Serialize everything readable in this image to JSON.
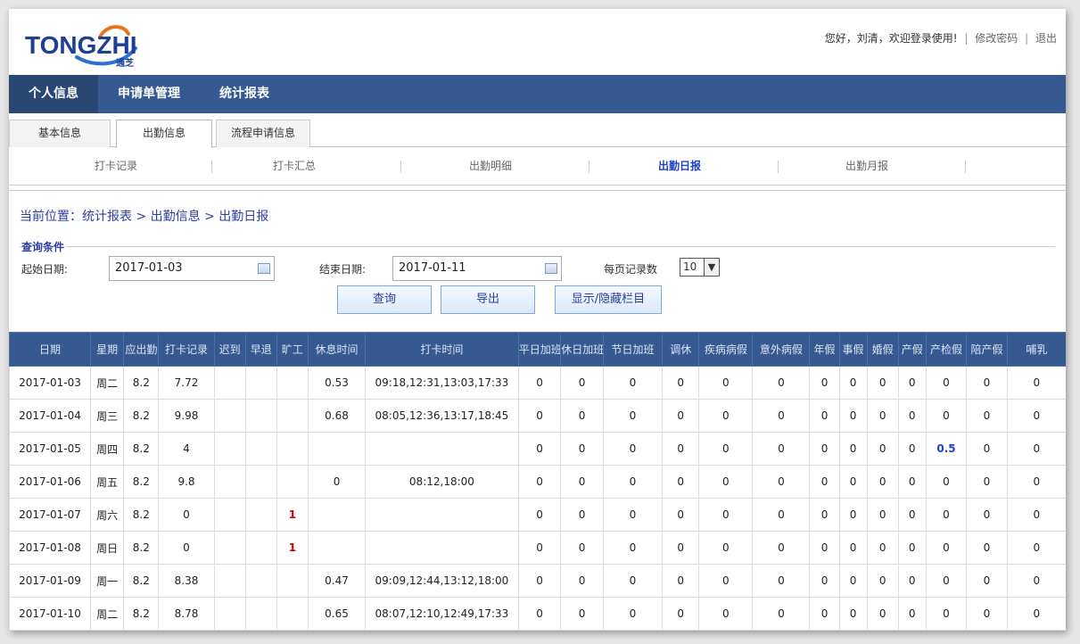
{
  "header": {
    "logo_text": "TONGZHI",
    "logo_sub": "通芝",
    "greeting": "您好，刘清，欢迎登录使用!",
    "change_password": "修改密码",
    "logout": "退出",
    "sep": "|"
  },
  "nav": [
    "个人信息",
    "申请单管理",
    "统计报表"
  ],
  "tabs": [
    "基本信息",
    "出勤信息",
    "流程申请信息"
  ],
  "subnav": [
    "打卡记录",
    "打卡汇总",
    "出勤明细",
    "出勤日报",
    "出勤月报"
  ],
  "breadcrumb": "当前位置：统计报表 > 出勤信息 > 出勤日报",
  "query": {
    "legend": "查询条件",
    "start_label": "起始日期:",
    "start_value": "2017-01-03",
    "end_label": "结束日期:",
    "end_value": "2017-01-11",
    "per_page_label": "每页记录数",
    "per_page_value": "10",
    "search_button": "查询",
    "export_button": "导出",
    "toggle_columns_button": "显示/隐藏栏目"
  },
  "table": {
    "columns": [
      "日期",
      "星期",
      "应出勤",
      "打卡记录",
      "迟到",
      "早退",
      "旷工",
      "休息时间",
      "打卡时间",
      "平日加班",
      "休日加班",
      "节日加班",
      "调休",
      "疾病病假",
      "意外病假",
      "年假",
      "事假",
      "婚假",
      "产假",
      "产检假",
      "陪产假",
      "哺乳"
    ],
    "rows": [
      [
        "2017-01-03",
        "周二",
        "8.2",
        "7.72",
        "",
        "",
        "",
        "0.53",
        "09:18,12:31,13:03,17:33",
        "0",
        "0",
        "0",
        "0",
        "0",
        "0",
        "0",
        "0",
        "0",
        "0",
        "0",
        "0",
        "0"
      ],
      [
        "2017-01-04",
        "周三",
        "8.2",
        "9.98",
        "",
        "",
        "",
        "0.68",
        "08:05,12:36,13:17,18:45",
        "0",
        "0",
        "0",
        "0",
        "0",
        "0",
        "0",
        "0",
        "0",
        "0",
        "0",
        "0",
        "0"
      ],
      [
        "2017-01-05",
        "周四",
        "8.2",
        "4",
        "",
        "",
        "",
        "",
        "",
        "0",
        "0",
        "0",
        "0",
        "0",
        "0",
        "0",
        "0",
        "0",
        "0",
        "0.5",
        "0",
        "0"
      ],
      [
        "2017-01-06",
        "周五",
        "8.2",
        "9.8",
        "",
        "",
        "",
        "0",
        "08:12,18:00",
        "0",
        "0",
        "0",
        "0",
        "0",
        "0",
        "0",
        "0",
        "0",
        "0",
        "0",
        "0",
        "0"
      ],
      [
        "2017-01-07",
        "周六",
        "8.2",
        "0",
        "",
        "",
        "1",
        "",
        "",
        "0",
        "0",
        "0",
        "0",
        "0",
        "0",
        "0",
        "0",
        "0",
        "0",
        "0",
        "0",
        "0"
      ],
      [
        "2017-01-08",
        "周日",
        "8.2",
        "0",
        "",
        "",
        "1",
        "",
        "",
        "0",
        "0",
        "0",
        "0",
        "0",
        "0",
        "0",
        "0",
        "0",
        "0",
        "0",
        "0",
        "0"
      ],
      [
        "2017-01-09",
        "周一",
        "8.2",
        "8.38",
        "",
        "",
        "",
        "0.47",
        "09:09,12:44,13:12,18:00",
        "0",
        "0",
        "0",
        "0",
        "0",
        "0",
        "0",
        "0",
        "0",
        "0",
        "0",
        "0",
        "0"
      ],
      [
        "2017-01-10",
        "周二",
        "8.2",
        "8.78",
        "",
        "",
        "",
        "0.65",
        "08:07,12:10,12:49,17:33",
        "0",
        "0",
        "0",
        "0",
        "0",
        "0",
        "0",
        "0",
        "0",
        "0",
        "0",
        "0",
        "0"
      ]
    ]
  },
  "colors": {
    "nav_bg": "#365992",
    "accent_blue": "#1e3fc8",
    "absent_red": "#d00000"
  }
}
